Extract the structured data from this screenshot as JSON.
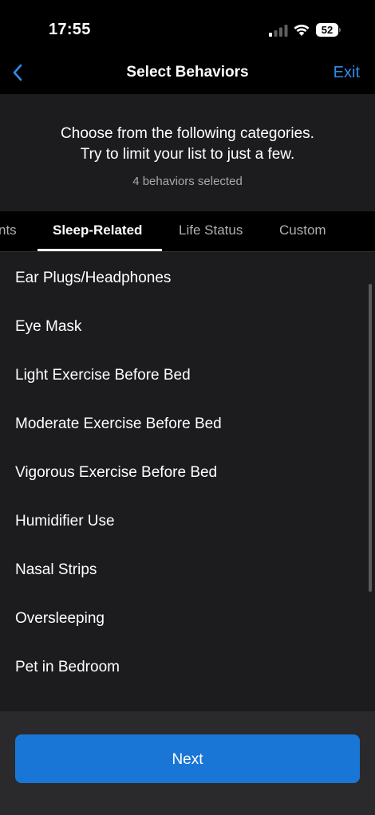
{
  "status_bar": {
    "time": "17:55",
    "battery_level": "52",
    "signal_icon": "cellular-signal-icon",
    "wifi_icon": "wifi-icon"
  },
  "nav": {
    "back_icon": "chevron-left-icon",
    "title": "Select Behaviors",
    "exit_label": "Exit"
  },
  "header": {
    "instruction_line1": "Choose from the following categories.",
    "instruction_line2": "Try to limit your list to just a few.",
    "selected_count": "4 behaviors selected"
  },
  "tabs": [
    {
      "label": "nts",
      "active": false
    },
    {
      "label": "Sleep-Related",
      "active": true
    },
    {
      "label": "Life Status",
      "active": false
    },
    {
      "label": "Custom",
      "active": false
    }
  ],
  "list": {
    "items": [
      "Ear Plugs/Headphones",
      "Eye Mask",
      "Light Exercise Before Bed",
      "Moderate Exercise Before Bed",
      "Vigorous Exercise Before Bed",
      "Humidifier Use",
      "Nasal Strips",
      "Oversleeping",
      "Pet in Bedroom"
    ]
  },
  "footer": {
    "next_label": "Next"
  },
  "colors": {
    "accent": "#2f8dea",
    "button": "#1a76d6",
    "panel": "#1c1c1e",
    "background": "#000000"
  }
}
